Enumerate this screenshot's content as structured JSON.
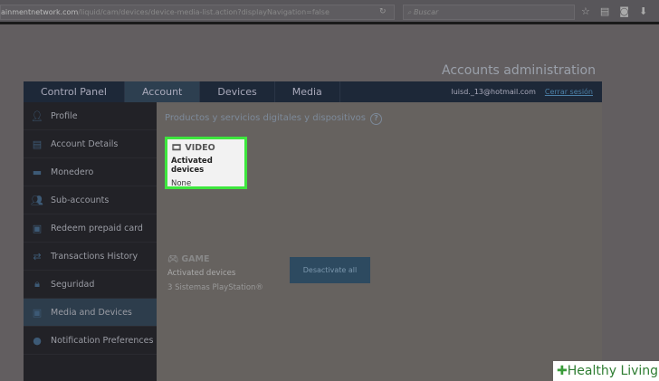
{
  "browser": {
    "url_domain": "ainmentnetwork.com",
    "url_path": "/liquid/cam/devices/device-media-list.action?displayNavigation=false",
    "search_placeholder": "Buscar"
  },
  "page_title": "Accounts administration",
  "nav": {
    "tabs": [
      "Control Panel",
      "Account",
      "Devices",
      "Media"
    ],
    "active": "Account",
    "user_email": "luisd._13@hotmail.com",
    "logout": "Cerrar sesión"
  },
  "sidebar": {
    "items": [
      {
        "label": "Profile",
        "icon": "user-icon"
      },
      {
        "label": "Account Details",
        "icon": "document-icon"
      },
      {
        "label": "Monedero",
        "icon": "wallet-icon"
      },
      {
        "label": "Sub-accounts",
        "icon": "users-icon"
      },
      {
        "label": "Redeem prepaid card",
        "icon": "gift-icon"
      },
      {
        "label": "Transactions History",
        "icon": "transfer-icon"
      },
      {
        "label": "Seguridad",
        "icon": "lock-icon"
      },
      {
        "label": "Media and Devices",
        "icon": "media-icon"
      },
      {
        "label": "Notification Preferences",
        "icon": "bell-icon"
      }
    ],
    "active": "Media and Devices"
  },
  "content": {
    "heading": "Productos y servicios digitales y dispositivos",
    "help": "?",
    "video": {
      "title": "VIDEO",
      "label": "Activated devices",
      "value": "None"
    },
    "game": {
      "title": "GAME",
      "label": "Activated devices",
      "value": "3 Sistemas PlayStation®",
      "button": "Desactivate all"
    }
  },
  "watermark": "Healthy Living"
}
